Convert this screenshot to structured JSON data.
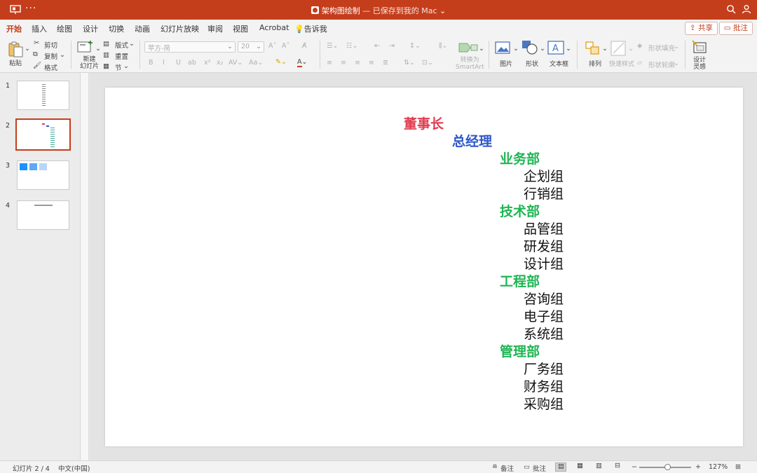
{
  "titlebar": {
    "dots": "···",
    "doc_name": "架构图绘制",
    "save_status": "— 已保存到我的 Mac"
  },
  "tabs": [
    {
      "label": "开始",
      "active": true
    },
    {
      "label": "插入"
    },
    {
      "label": "绘图"
    },
    {
      "label": "设计"
    },
    {
      "label": "切换"
    },
    {
      "label": "动画"
    },
    {
      "label": "幻灯片放映"
    },
    {
      "label": "审阅"
    },
    {
      "label": "视图"
    },
    {
      "label": "Acrobat"
    },
    {
      "label": "告诉我"
    }
  ],
  "share_label": "共享",
  "comment_label": "批注",
  "ribbon": {
    "paste": "粘贴",
    "cut": "剪切",
    "copy": "复制",
    "format": "格式",
    "new_slide_1": "新建",
    "new_slide_2": "幻灯片",
    "layout": "版式",
    "reset": "重置",
    "section": "节",
    "font_name": "苹方-简",
    "font_size": "20",
    "convert_1": "转换为",
    "convert_2": "SmartArt",
    "picture": "图片",
    "shape": "形状",
    "textbox": "文本框",
    "arrange": "排列",
    "quick_styles": "快速样式",
    "shape_fill": "形状填充",
    "shape_outline": "形状轮廓",
    "designer_1": "设计",
    "designer_2": "灵感"
  },
  "thumbnails": [
    "1",
    "2",
    "3",
    "4"
  ],
  "slide": {
    "lines": [
      {
        "text": "董事长",
        "level": 0
      },
      {
        "text": "总经理",
        "level": 1
      },
      {
        "text": "业务部",
        "level": 2
      },
      {
        "text": "企划组",
        "level": 3
      },
      {
        "text": "行销组",
        "level": 3
      },
      {
        "text": "技术部",
        "level": 2
      },
      {
        "text": "品管组",
        "level": 3
      },
      {
        "text": "研发组",
        "level": 3
      },
      {
        "text": "设计组",
        "level": 3
      },
      {
        "text": "工程部",
        "level": 2
      },
      {
        "text": "咨询组",
        "level": 3
      },
      {
        "text": "电子组",
        "level": 3
      },
      {
        "text": "系统组",
        "level": 3
      },
      {
        "text": "管理部",
        "level": 2
      },
      {
        "text": "厂务组",
        "level": 3
      },
      {
        "text": "财务组",
        "level": 3
      },
      {
        "text": "采购组",
        "level": 3
      }
    ],
    "level_colors": [
      "#e03c4f",
      "#2e57c8",
      "#1fb553",
      "#111111"
    ]
  },
  "statusbar": {
    "slide_counter": "幻灯片 2 / 4",
    "language": "中文(中国)",
    "notes": "备注",
    "comments": "批注",
    "zoom": "127%"
  }
}
